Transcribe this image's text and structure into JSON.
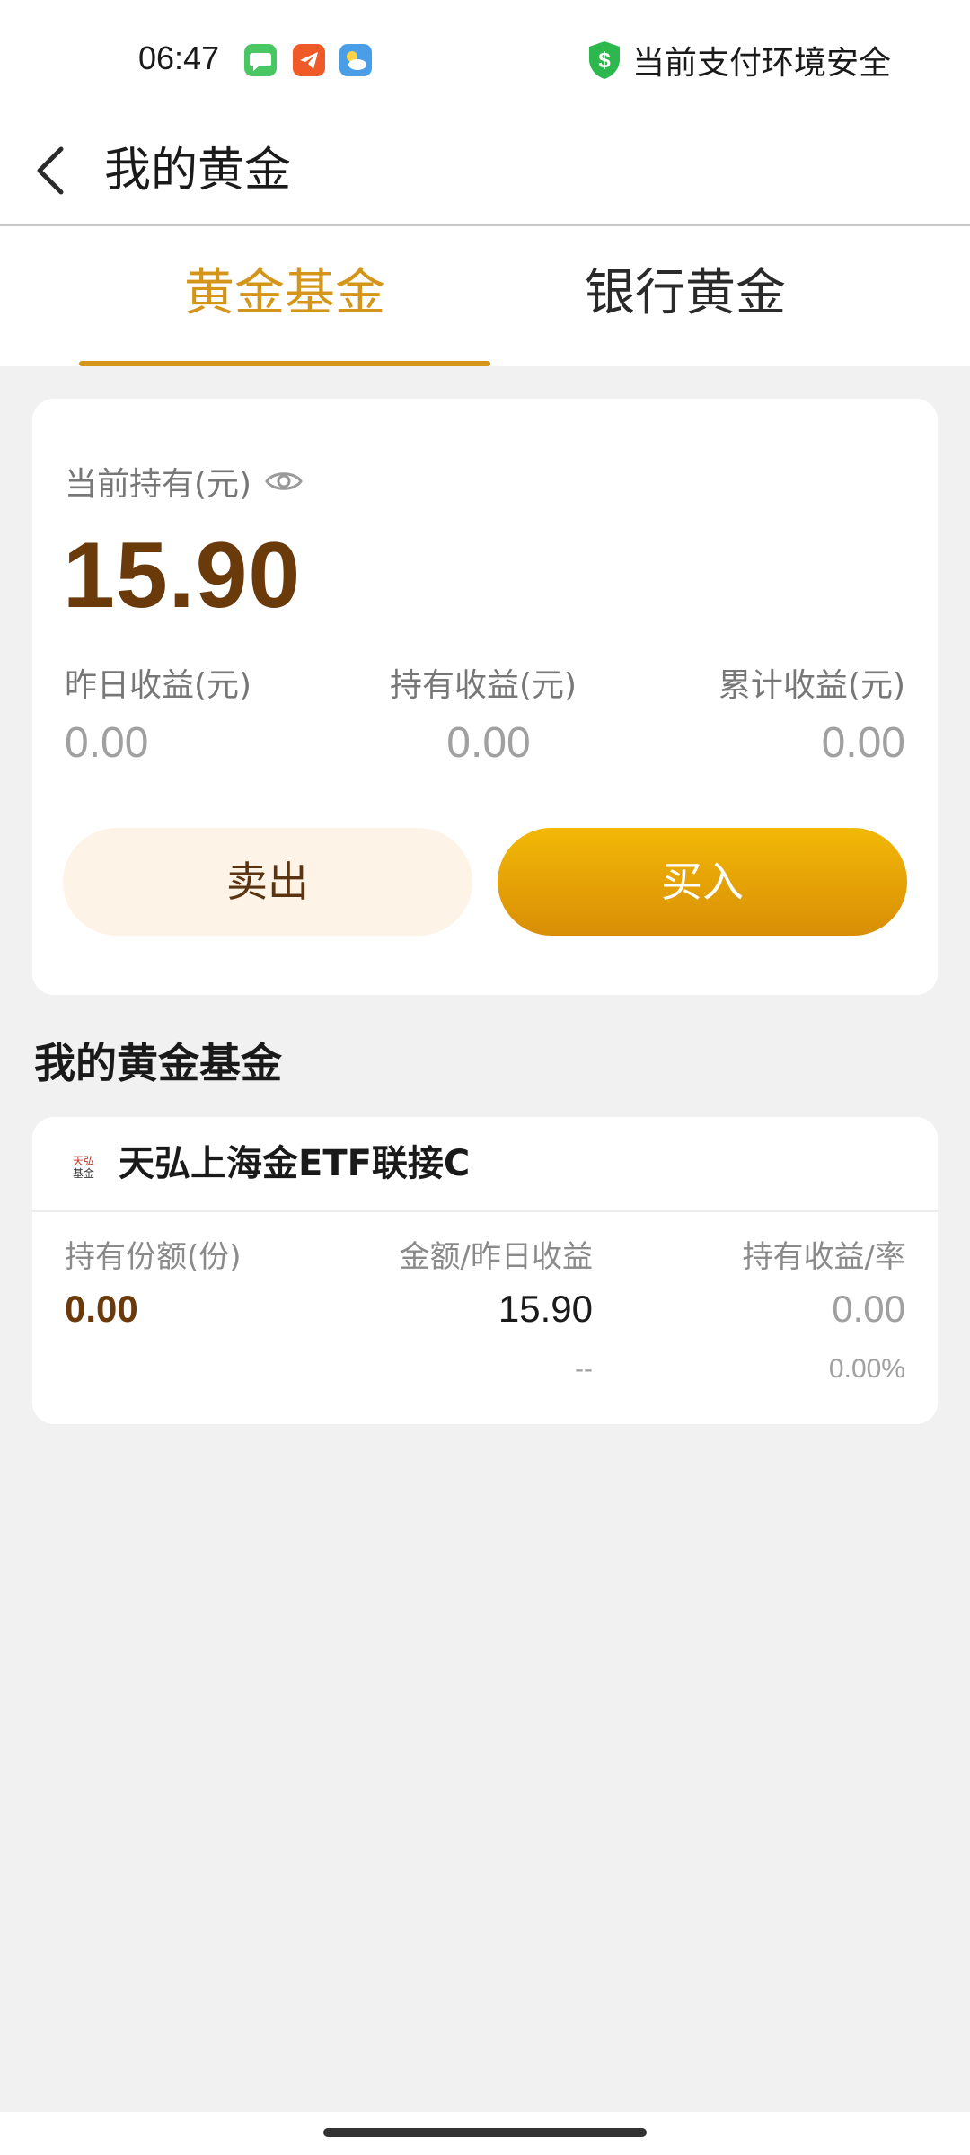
{
  "status_bar": {
    "time": "06:47",
    "apps": [
      "messages-icon",
      "telegram-icon",
      "weather-icon"
    ],
    "security_text": "当前支付环境安全"
  },
  "header": {
    "title": "我的黄金"
  },
  "tabs": [
    {
      "label": "黄金基金",
      "active": true
    },
    {
      "label": "银行黄金",
      "active": false
    }
  ],
  "holdings": {
    "label": "当前持有(元)",
    "value": "15.90",
    "stats": [
      {
        "label": "昨日收益(元)",
        "value": "0.00"
      },
      {
        "label": "持有收益(元)",
        "value": "0.00"
      },
      {
        "label": "累计收益(元)",
        "value": "0.00"
      }
    ],
    "sell_label": "卖出",
    "buy_label": "买入"
  },
  "section": {
    "title": "我的黄金基金"
  },
  "fund": {
    "name": "天弘上海金ETF联接C",
    "logo_text": "天弘基金",
    "columns": [
      {
        "header": "持有份额(份)",
        "value": "0.00",
        "sub": ""
      },
      {
        "header": "金额/昨日收益",
        "value": "15.90",
        "sub": "--"
      },
      {
        "header": "持有收益/率",
        "value": "0.00",
        "sub": "0.00%"
      }
    ]
  },
  "colors": {
    "accent_gold": "#d4951a",
    "brown": "#6b3a0b",
    "buy_button_top": "#f2b807",
    "buy_button_bottom": "#d98e06",
    "sell_button_bg": "#fdf3e6",
    "security_green": "#2db84d"
  }
}
